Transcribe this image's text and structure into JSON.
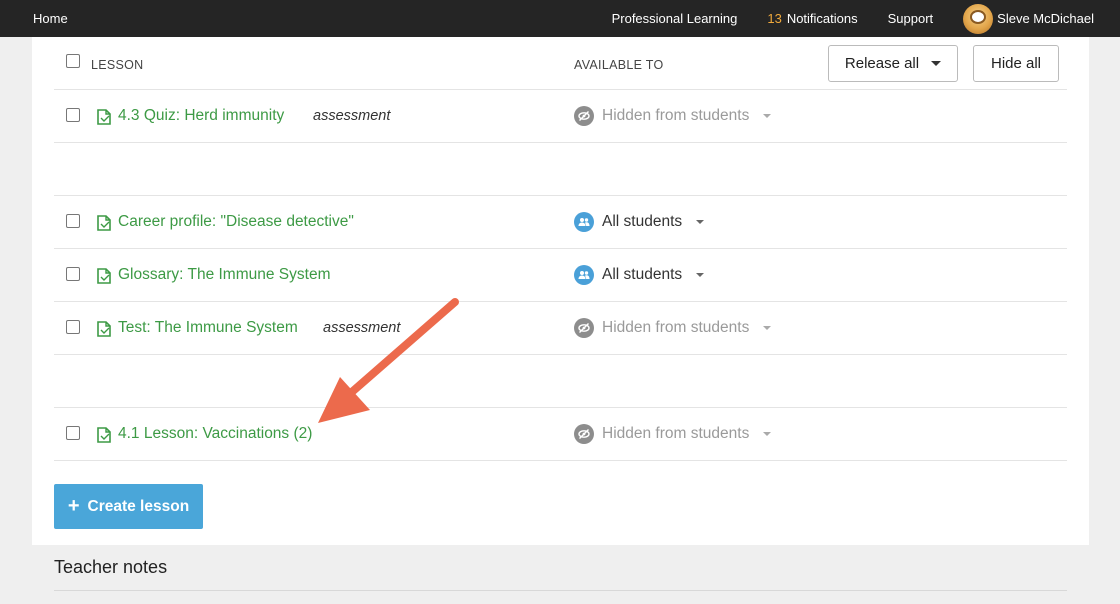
{
  "nav": {
    "home": "Home",
    "professional_learning": "Professional Learning",
    "notifications_count": "13",
    "notifications_label": "Notifications",
    "support": "Support",
    "user_name": "Sleve McDichael"
  },
  "table": {
    "col_lesson": "LESSON",
    "col_available": "AVAILABLE TO",
    "release_all": "Release all",
    "hide_all": "Hide all"
  },
  "rows": [
    {
      "title": "4.3 Quiz: Herd immunity",
      "tag": "assessment",
      "availability": "Hidden from students"
    },
    {
      "title": "Career profile: \"Disease detective\"",
      "tag": "",
      "availability": "All students"
    },
    {
      "title": "Glossary: The Immune System",
      "tag": "",
      "availability": "All students"
    },
    {
      "title": "Test: The Immune System",
      "tag": "assessment",
      "availability": "Hidden from students"
    },
    {
      "title": "4.1 Lesson: Vaccinations (2)",
      "tag": "",
      "availability": "Hidden from students"
    }
  ],
  "create_lesson": "Create lesson",
  "teacher_notes": "Teacher notes",
  "colors": {
    "link_green": "#3d9a45",
    "primary_blue": "#4aa6d9",
    "arrow_red": "#ec6a4c",
    "nav_bg": "#252525",
    "notif_orange": "#f0a93c"
  }
}
